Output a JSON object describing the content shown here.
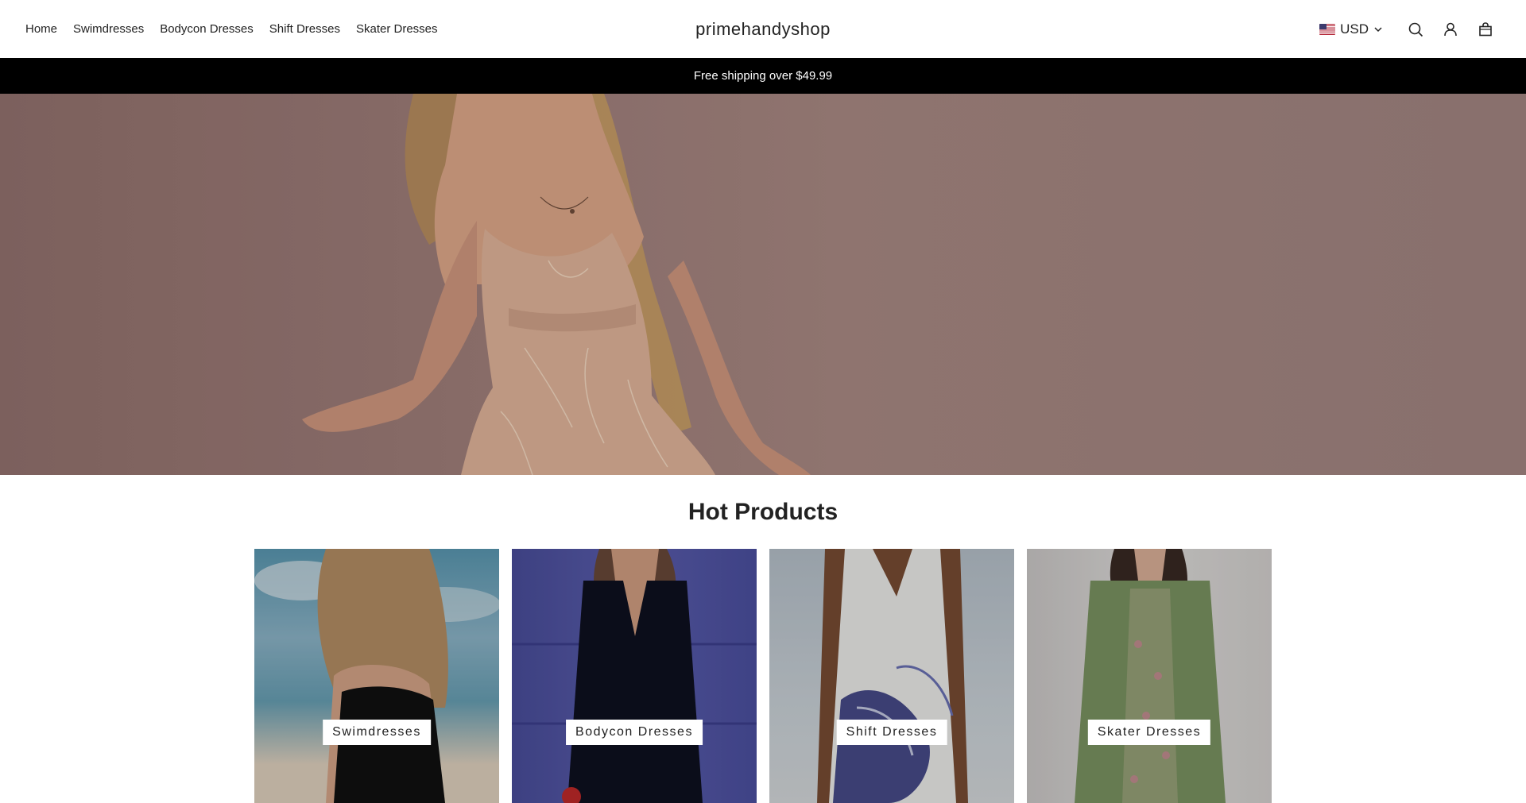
{
  "header": {
    "nav": [
      {
        "label": "Home"
      },
      {
        "label": "Swimdresses"
      },
      {
        "label": "Bodycon Dresses"
      },
      {
        "label": "Shift Dresses"
      },
      {
        "label": "Skater Dresses"
      }
    ],
    "logo": "primehandyshop",
    "currency": "USD",
    "icons": [
      "flag-us-icon",
      "chevron-down-icon",
      "search-icon",
      "account-icon",
      "cart-icon"
    ]
  },
  "announcement": {
    "text": "Free shipping over $49.99"
  },
  "hero": {
    "image": "model-in-sequin-gown"
  },
  "section": {
    "title": "Hot Products"
  },
  "categories": [
    {
      "label": "Swimdresses"
    },
    {
      "label": "Bodycon Dresses"
    },
    {
      "label": "Shift Dresses"
    },
    {
      "label": "Skater Dresses"
    }
  ]
}
